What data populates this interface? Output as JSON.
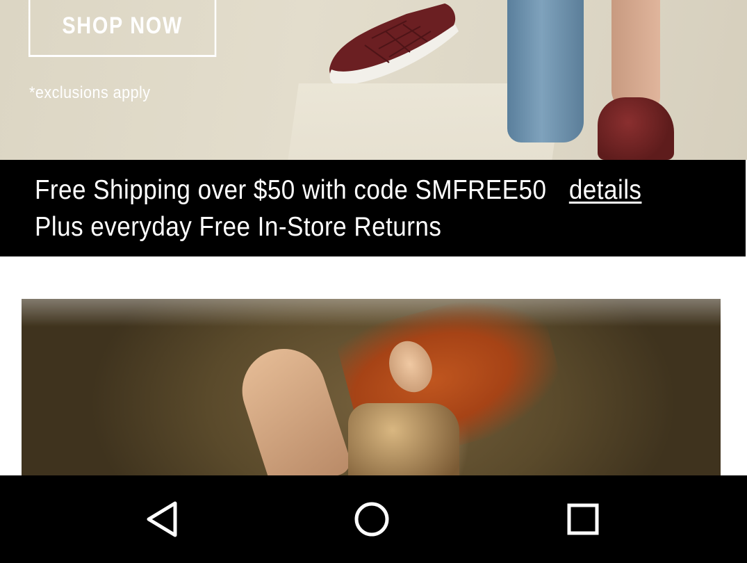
{
  "hero": {
    "cta_label": "SHOP NOW",
    "exclusions_note": "*exclusions apply"
  },
  "promo": {
    "shipping_text": "Free Shipping over $50 with code SMFREE50",
    "details_link": "details",
    "returns_text": "Plus everyday Free In-Store Returns"
  },
  "navbar": {
    "back_icon": "back-icon",
    "home_icon": "home-icon",
    "recents_icon": "recents-icon"
  },
  "colors": {
    "promo_background": "#000000",
    "promo_text": "#ffffff",
    "navbar_background": "#000000"
  }
}
